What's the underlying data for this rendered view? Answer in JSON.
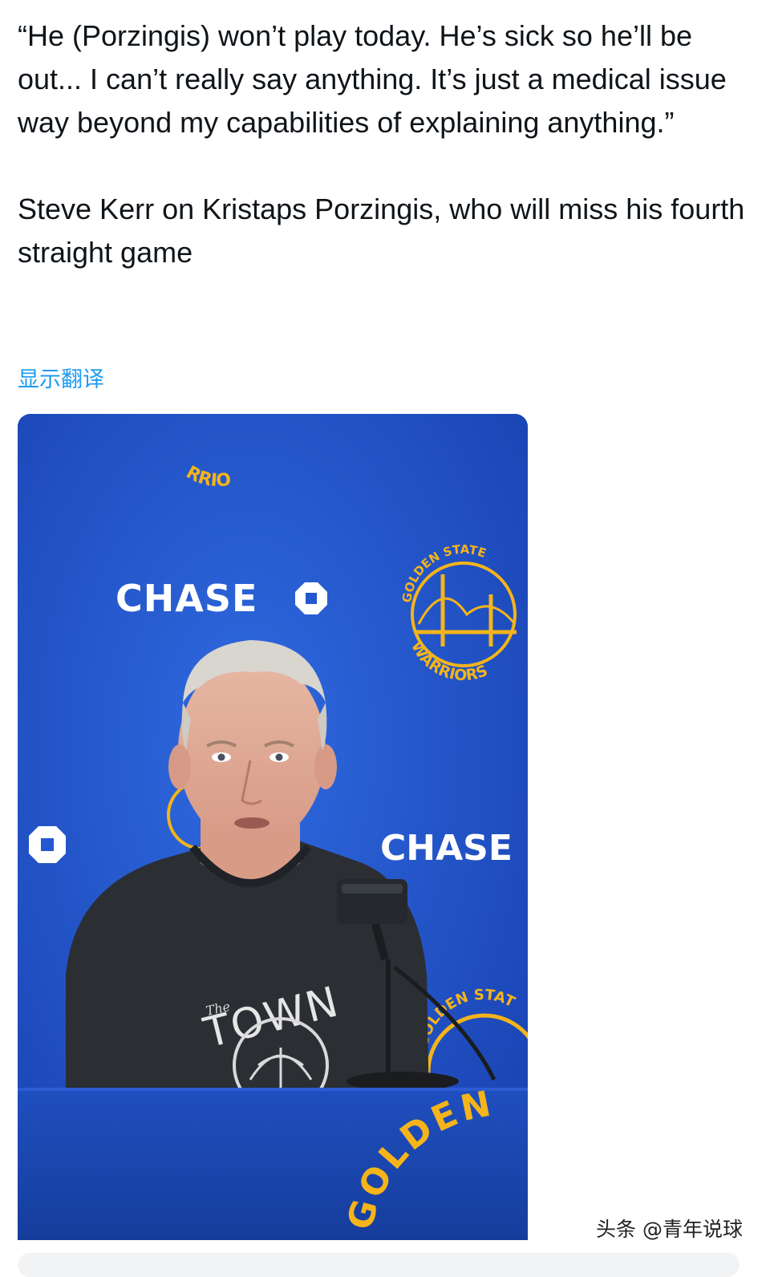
{
  "tweet": {
    "quote": "“He (Porzingis) won’t play today. He’s sick so he’ll be out... I can’t really say anything. It’s just a medical issue way beyond my capabilities of explaining anything.”",
    "caption": "Steve Kerr on Kristaps Porzingis, who will miss his fourth straight game",
    "translate_label": "显示翻译"
  },
  "media": {
    "sponsor_text": "CHASE",
    "sponsor_text_2": "CHASE",
    "team_arc_top": "GOLDEN STATE",
    "team_arc_bottom": "WARRIORS",
    "top_arc_fragment": "RRIO",
    "shirt_small": "The",
    "shirt_word": "TOWN",
    "podium_text": "GOLDEN",
    "side_logo_fragment": "GOLDEN STAT",
    "colors": {
      "backdrop_blue": "#1f4fc9",
      "warriors_gold": "#f4b41a",
      "shirt": "#2b2e33"
    }
  },
  "footer": {
    "watermark": "头条 @青年说球"
  }
}
